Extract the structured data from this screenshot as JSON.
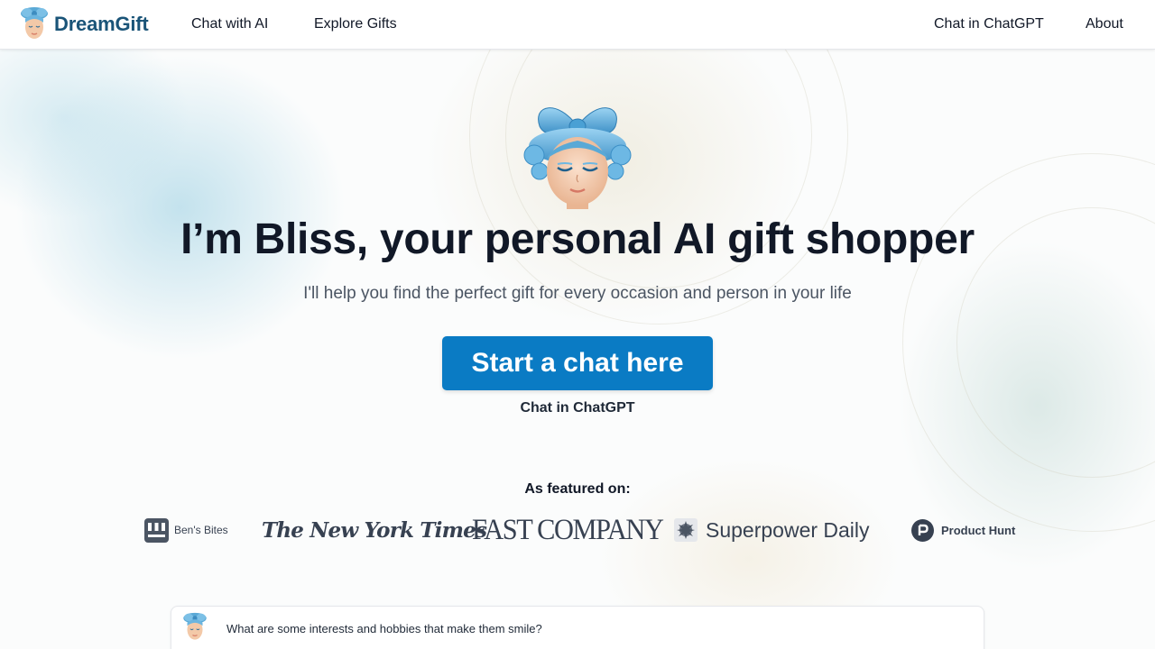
{
  "nav": {
    "brand": "DreamGift",
    "links_left": [
      "Chat with AI",
      "Explore Gifts"
    ],
    "links_right": [
      "Chat in ChatGPT",
      "About"
    ]
  },
  "hero": {
    "headline": "I’m Bliss, your personal AI gift shopper",
    "subhead": "I'll help you find the perfect gift for every occasion and person in your life",
    "cta_label": "Start a chat here",
    "secondary_link": "Chat in ChatGPT"
  },
  "featured": {
    "label": "As featured on:",
    "logos": [
      {
        "name": "Ben's Bites",
        "text": "Ben's Bites"
      },
      {
        "name": "The New York Times",
        "text": "The New York Times"
      },
      {
        "name": "Fast Company",
        "text": "FAST COMPANY"
      },
      {
        "name": "Superpower Daily",
        "text": "Superpower Daily"
      },
      {
        "name": "Product Hunt",
        "text": "Product Hunt"
      }
    ]
  },
  "chat_preview": {
    "message": "What are some interests and hobbies that make them smile?"
  },
  "colors": {
    "brand": "#1a5478",
    "cta": "#0a7bc4",
    "text": "#111827",
    "muted": "#4b5563"
  }
}
